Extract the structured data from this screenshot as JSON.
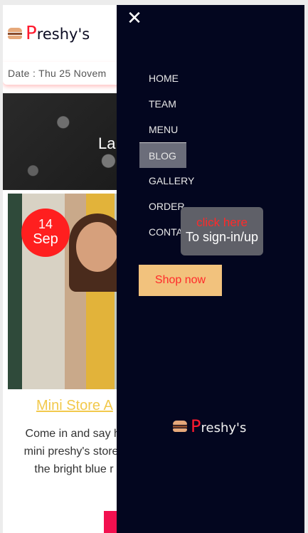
{
  "header": {
    "logo_initial": "P",
    "logo_rest": "reshy's",
    "date_text": "Date : Thu 25 Novem"
  },
  "hero": {
    "text": "La"
  },
  "card": {
    "badge_day": "14",
    "badge_month": "Sep",
    "title": "Mini Store A",
    "body_lines": [
      "Come in and say hi",
      "mini preshy's store l",
      "the bright blue r"
    ]
  },
  "nav": {
    "close_glyph": "✕",
    "items": [
      {
        "label": "HOME",
        "active": false
      },
      {
        "label": "TEAM",
        "active": false
      },
      {
        "label": "MENU",
        "active": false
      },
      {
        "label": "BLOG",
        "active": true
      },
      {
        "label": "GALLERY",
        "active": false
      },
      {
        "label": "ORDER",
        "active": false
      },
      {
        "label": "CONTACT",
        "active": false
      }
    ],
    "tooltip_line1": "click here",
    "tooltip_line2": "To sign-in/up",
    "shop_label": "Shop now",
    "logo_initial": "P",
    "logo_rest": "reshy's"
  },
  "colors": {
    "accent_red": "#ff1a2e",
    "nav_bg": "#03061f",
    "shop_bg": "#f2c27d",
    "title_yellow": "#f2c94c"
  }
}
